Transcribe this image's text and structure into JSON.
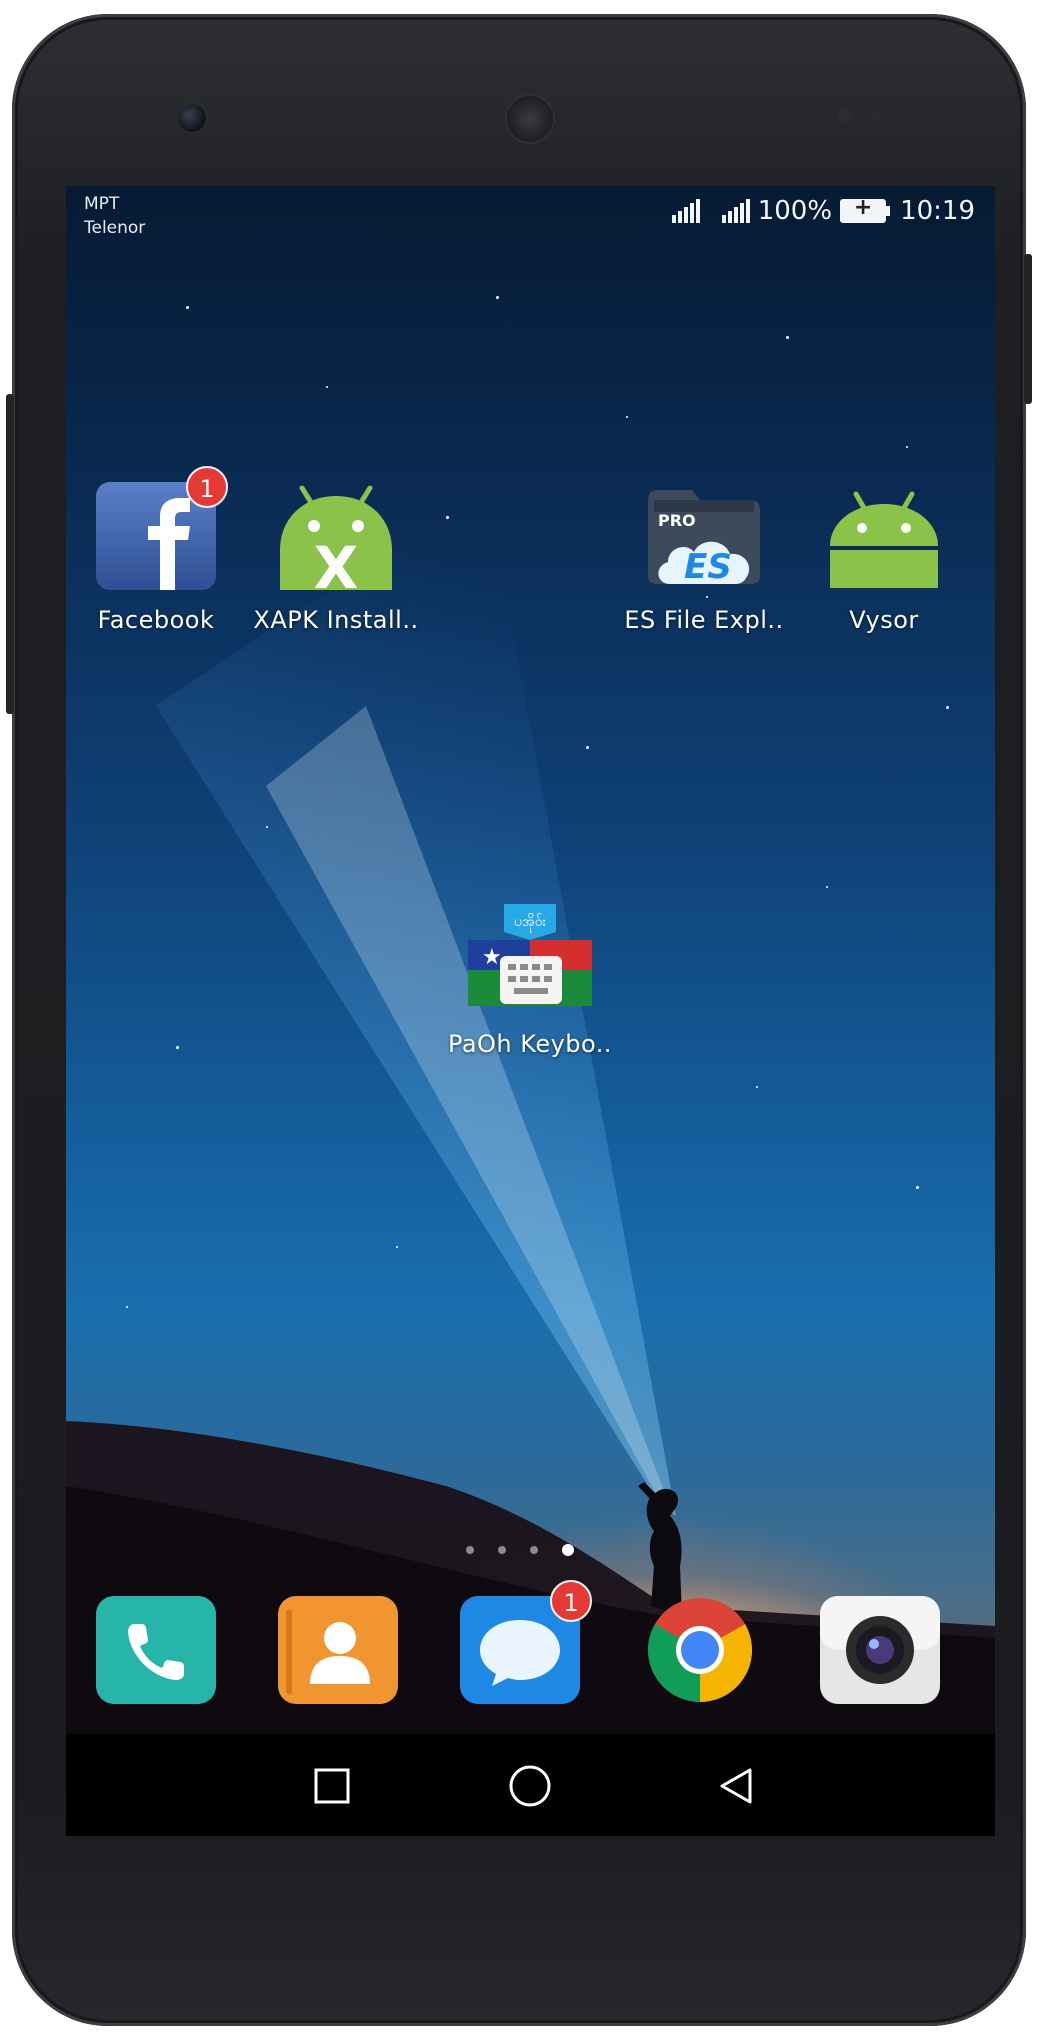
{
  "status_bar": {
    "carrier_1": "MPT",
    "carrier_2": "Telenor",
    "battery_percent": "100%",
    "time": "10:19",
    "battery_charging": true
  },
  "home_apps": [
    {
      "label": "Facebook",
      "icon": "facebook-icon",
      "badge": "1"
    },
    {
      "label": "XAPK Install..",
      "icon": "xapk-installer-icon"
    },
    {
      "label": "ES File Expl..",
      "icon": "es-file-explorer-icon"
    },
    {
      "label": "Vysor",
      "icon": "vysor-icon"
    },
    {
      "label": "PaOh Keybo..",
      "icon": "paoh-keyboard-icon"
    }
  ],
  "page_indicator": {
    "pages": 4,
    "current": 4
  },
  "dock": [
    {
      "icon": "phone-dialer-icon",
      "color": "#26b5a8"
    },
    {
      "icon": "contacts-icon",
      "color": "#f0952f"
    },
    {
      "icon": "messages-icon",
      "color": "#1e88e5",
      "badge": "1"
    },
    {
      "icon": "chrome-icon"
    },
    {
      "icon": "camera-icon",
      "color": "#e6e6e6"
    }
  ],
  "nav": {
    "recents": "square-icon",
    "home": "circle-icon",
    "back": "triangle-back-icon"
  },
  "colors": {
    "badge": "#e53935",
    "facebook_blue": "#3b5998",
    "android_green": "#8bc34a"
  }
}
